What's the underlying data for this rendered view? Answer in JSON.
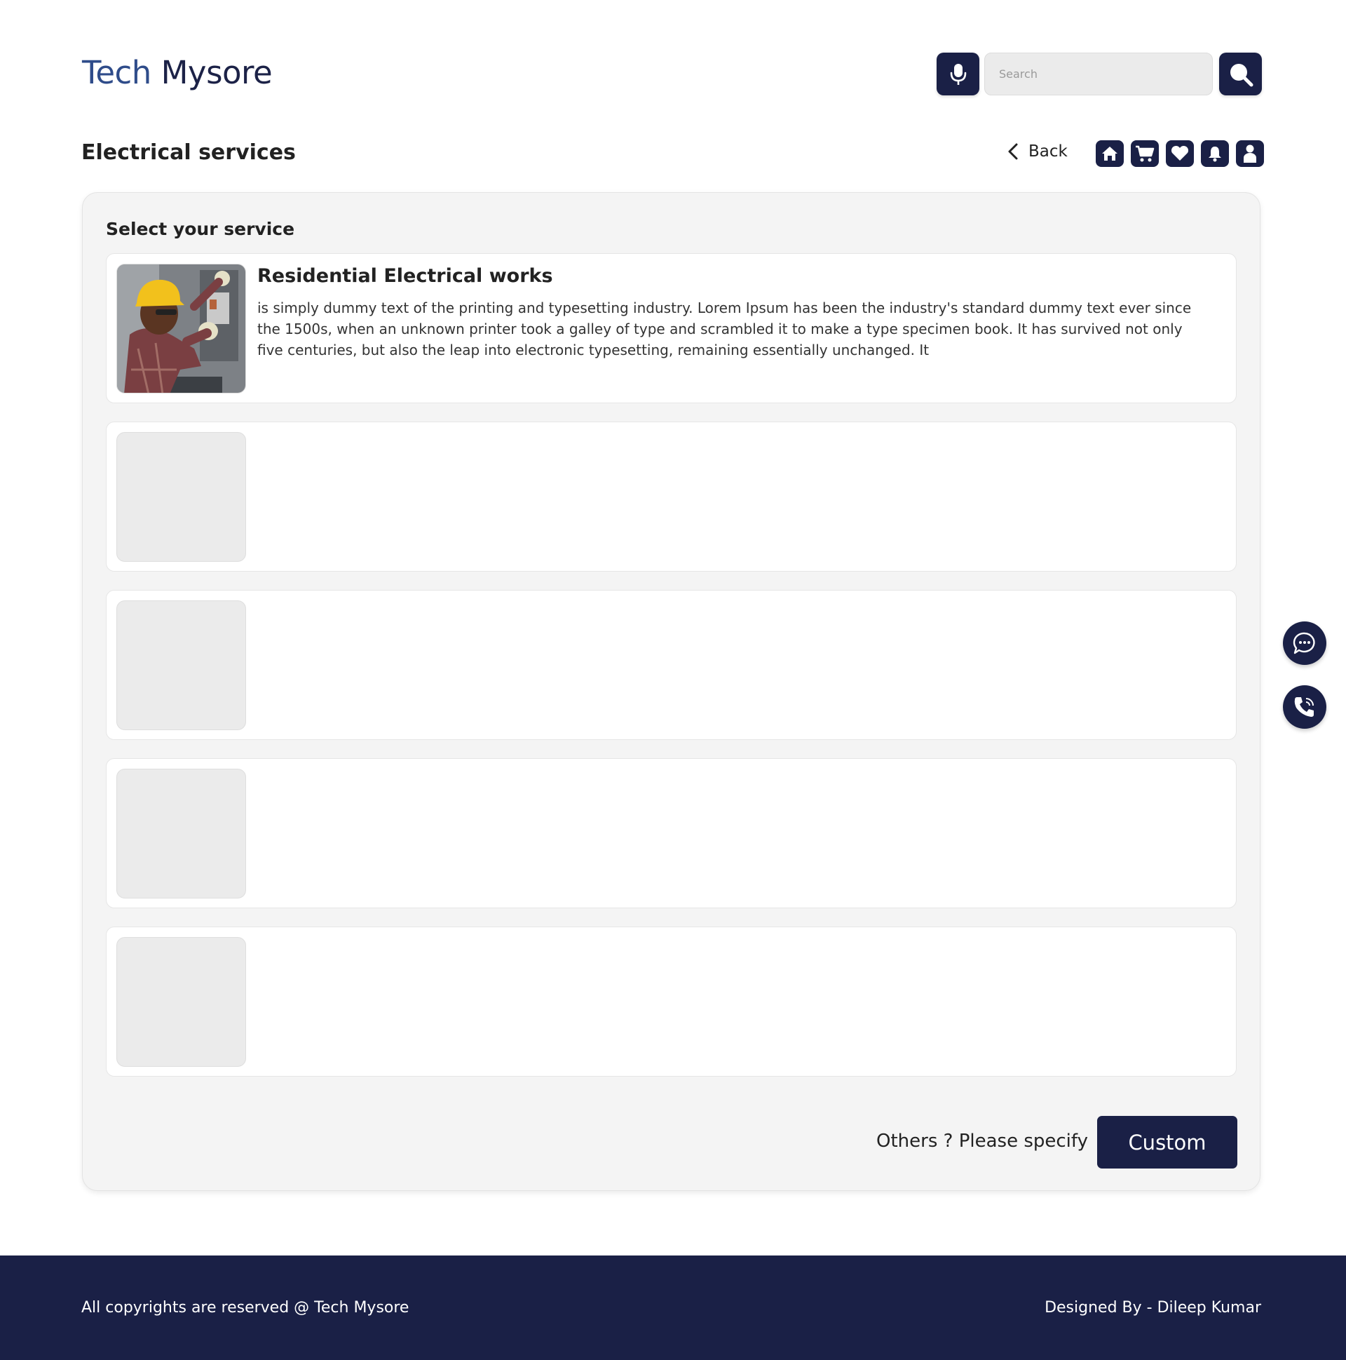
{
  "brand": {
    "word1": "Tech",
    "word2": "Mysore"
  },
  "search": {
    "placeholder": "Search"
  },
  "page": {
    "title": "Electrical services",
    "back_label": "Back"
  },
  "nav_icons": [
    "home-icon",
    "cart-icon",
    "heart-icon",
    "bell-icon",
    "user-icon"
  ],
  "panel": {
    "title": "Select your service",
    "services": [
      {
        "name": "Residential Electrical works",
        "description": "is simply dummy text of the printing and typesetting industry. Lorem Ipsum has been the industry's standard dummy text ever since the 1500s, when an unknown printer took a galley of type and scrambled it to make a type specimen book. It has survived not only five centuries, but also the leap into electronic typesetting, remaining essentially unchanged. It"
      },
      {
        "name": "",
        "description": ""
      },
      {
        "name": "",
        "description": ""
      },
      {
        "name": "",
        "description": ""
      },
      {
        "name": "",
        "description": ""
      }
    ],
    "others_label": "Others ? Please specify",
    "custom_button": "Custom"
  },
  "floating": [
    "chat-icon",
    "phone-icon"
  ],
  "footer": {
    "copyright": "All copyrights are reserved @ Tech Mysore",
    "designer": "Designed By - Dileep Kumar"
  },
  "colors": {
    "navy": "#1a2046",
    "brand_blue": "#2f4c8a",
    "panel_bg": "#f4f4f4"
  }
}
